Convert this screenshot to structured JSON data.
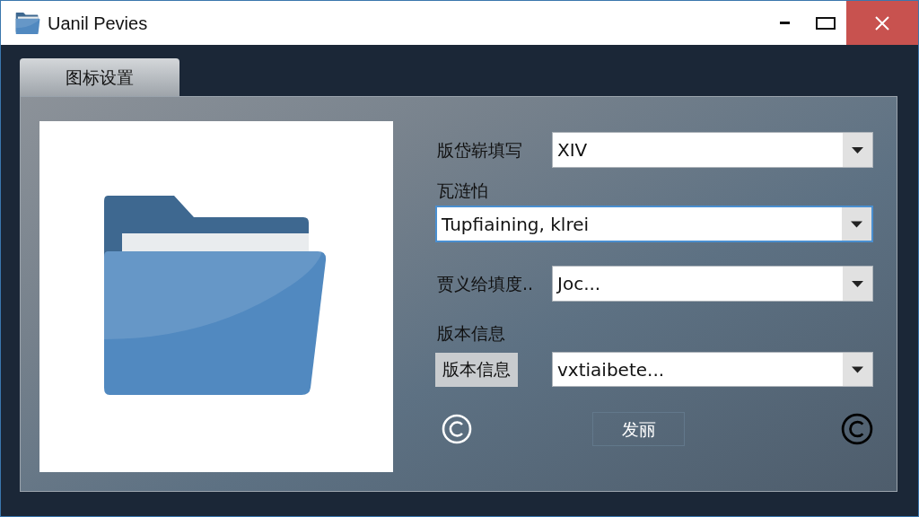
{
  "window": {
    "title": "Uanil Pevies"
  },
  "tabs": [
    {
      "label": "图标设置",
      "selected": true
    }
  ],
  "form": {
    "rows": [
      {
        "kind": "inline",
        "label": "版岱崭填写",
        "value": "XIV",
        "focused": false
      },
      {
        "kind": "stacked",
        "label": "瓦涟怕",
        "value": "Tupfiaining, klrei",
        "focused": true
      },
      {
        "kind": "inline",
        "label": "贾义给填度..",
        "value": "Joc...",
        "focused": false
      },
      {
        "kind": "button",
        "label": "版本信息",
        "button": "版本信息",
        "value": "vxtiaibete...",
        "focused": false
      }
    ]
  },
  "footer": {
    "button": "发丽"
  }
}
